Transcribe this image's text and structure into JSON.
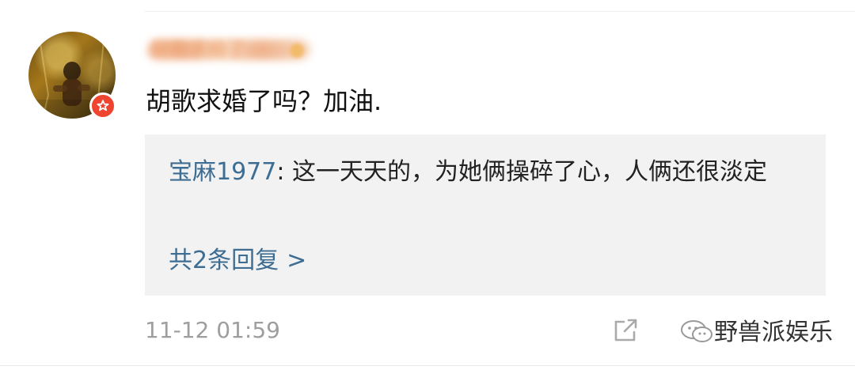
{
  "user": {
    "name": "胡歌求婚了",
    "avatar_icon": "person-photo-icon",
    "badge_icon": "star-badge-icon",
    "badge_color": "#ef4530"
  },
  "comment": {
    "text": "胡歌求婚了吗？加油."
  },
  "reply": {
    "author": "宝麻1977",
    "separator": ":",
    "text": " 这一天天的，为她俩操碎了心，人俩还很淡定",
    "count_label": "共2条回复",
    "chevron": ">"
  },
  "footer": {
    "timestamp": "11-12 01:59",
    "share_icon": "share-icon"
  },
  "watermark": {
    "icon": "wechat-icon",
    "text": "野兽派娱乐"
  },
  "colors": {
    "accent": "#3d6d93",
    "timestamp": "#9e9e9e",
    "background": "#ffffff",
    "reply_background": "#f2f2f2"
  }
}
